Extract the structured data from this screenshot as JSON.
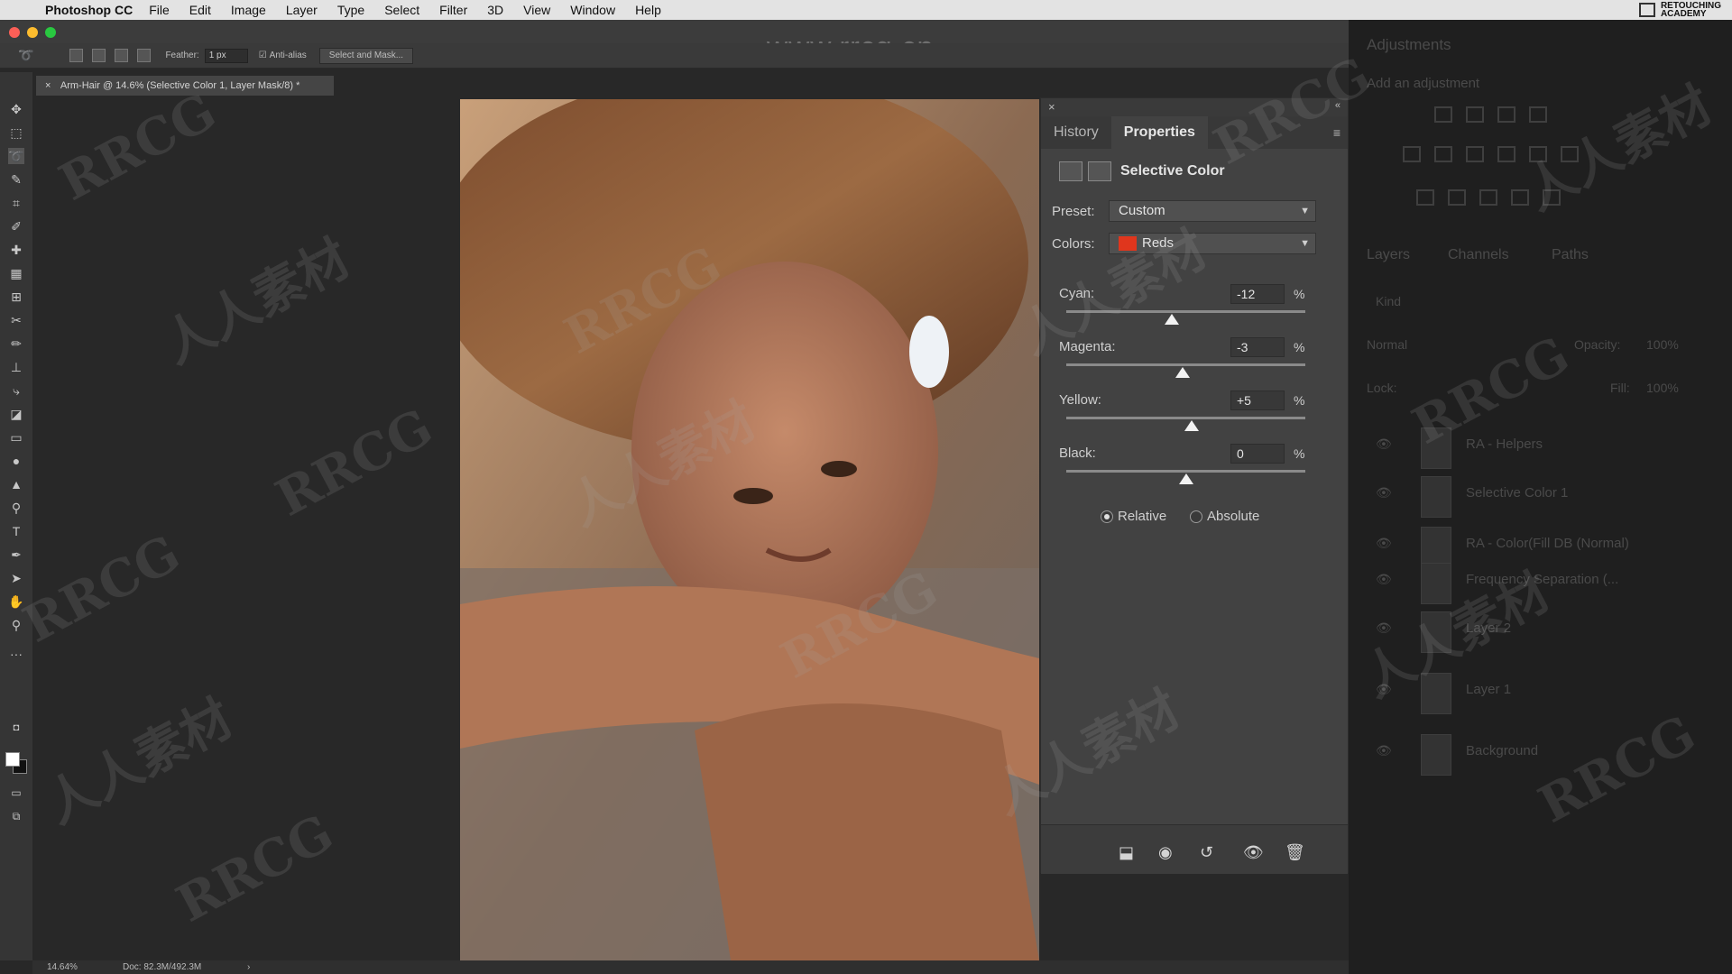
{
  "menubar": {
    "app_name": "Photoshop CC",
    "items": [
      "File",
      "Edit",
      "Image",
      "Layer",
      "Type",
      "Select",
      "Filter",
      "3D",
      "View",
      "Window",
      "Help"
    ],
    "right_logo_line1": "RETOUCHING",
    "right_logo_line2": "ACADEMY"
  },
  "watermark_url": "www.rrcg.cn",
  "options_bar": {
    "feather_label": "Feather:",
    "feather_value": "1 px",
    "antialias_label": "Anti-alias",
    "select_mask_button": "Select and Mask..."
  },
  "document": {
    "tab_title": "Arm-Hair @ 14.6% (Selective Color 1, Layer Mask/8) *",
    "zoom": "14.64%",
    "doc_size": "Doc: 82.3M/492.3M"
  },
  "properties_panel": {
    "tabs": [
      {
        "label": "History"
      },
      {
        "label": "Properties"
      }
    ],
    "active_tab": "Properties",
    "title": "Selective Color",
    "preset_label": "Preset:",
    "preset_value": "Custom",
    "colors_label": "Colors:",
    "colors_value": "Reds",
    "colors_swatch": "#e0361d",
    "sliders": [
      {
        "label": "Cyan:",
        "value": "-12",
        "unit": "%",
        "level": -12
      },
      {
        "label": "Magenta:",
        "value": "-3",
        "unit": "%",
        "level": -3
      },
      {
        "label": "Yellow:",
        "value": "+5",
        "unit": "%",
        "level": 5
      },
      {
        "label": "Black:",
        "value": "0",
        "unit": "%",
        "level": 0
      }
    ],
    "method_options": [
      {
        "label": "Relative",
        "selected": true
      },
      {
        "label": "Absolute",
        "selected": false
      }
    ]
  },
  "right_panels": {
    "adjustments_title": "Adjustments",
    "adjustments_sub": "Add an adjustment",
    "tabs": [
      "Layers",
      "Channels",
      "Paths"
    ],
    "kind_label": "Kind",
    "blend_mode": "Normal",
    "opacity_label": "Opacity:",
    "opacity_value": "100%",
    "lock_label": "Lock:",
    "fill_label": "Fill:",
    "fill_value": "100%",
    "layers": [
      {
        "name": "RA - Helpers"
      },
      {
        "name": "Selective Color 1"
      },
      {
        "name": "RA - Color(Fill DB (Normal)"
      },
      {
        "name": "Frequency Separation (..."
      },
      {
        "name": "Layer 2"
      },
      {
        "name": "Layer 1"
      },
      {
        "name": "Background"
      }
    ]
  },
  "colors": {
    "accent_red": "#e0361d",
    "panel_bg": "#424242"
  }
}
